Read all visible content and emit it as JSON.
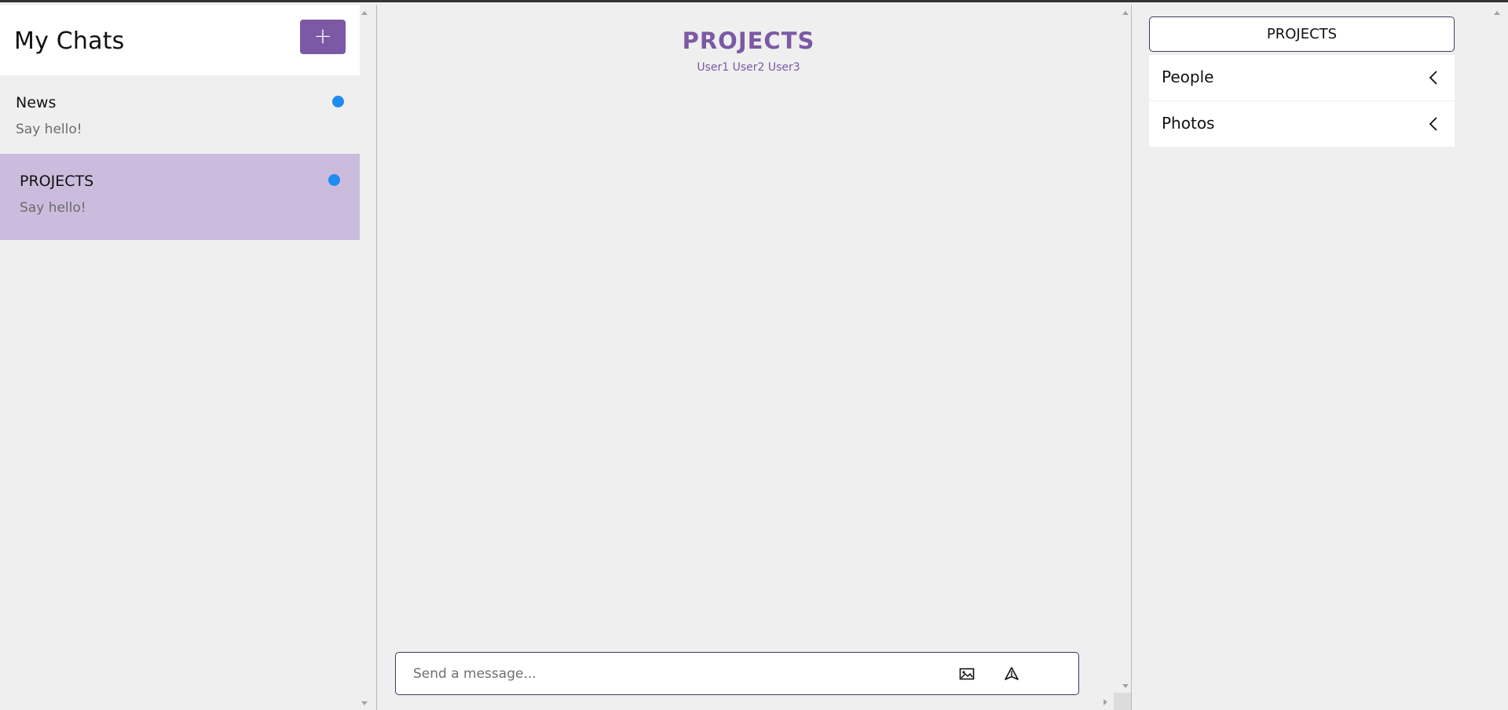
{
  "sidebar": {
    "title": "My Chats",
    "new_chat_label": "+",
    "chats": [
      {
        "name": "News",
        "preview": "Say hello!",
        "unread": true,
        "active": false
      },
      {
        "name": "PROJECTS",
        "preview": "Say hello!",
        "unread": true,
        "active": true
      }
    ]
  },
  "conversation": {
    "title": "PROJECTS",
    "members": "User1 User2 User3",
    "composer": {
      "placeholder": "Send a message...",
      "value": "",
      "attach_icon": "image-icon",
      "send_icon": "send-icon"
    }
  },
  "details": {
    "title": "PROJECTS",
    "sections": [
      {
        "label": "People",
        "icon": "chevron-left-icon"
      },
      {
        "label": "Photos",
        "icon": "chevron-left-icon"
      }
    ]
  },
  "colors": {
    "accent": "#7b59a4",
    "active_chat_bg": "#cbbcdd",
    "unread_dot": "#1e8cf0",
    "background": "#efefef"
  }
}
